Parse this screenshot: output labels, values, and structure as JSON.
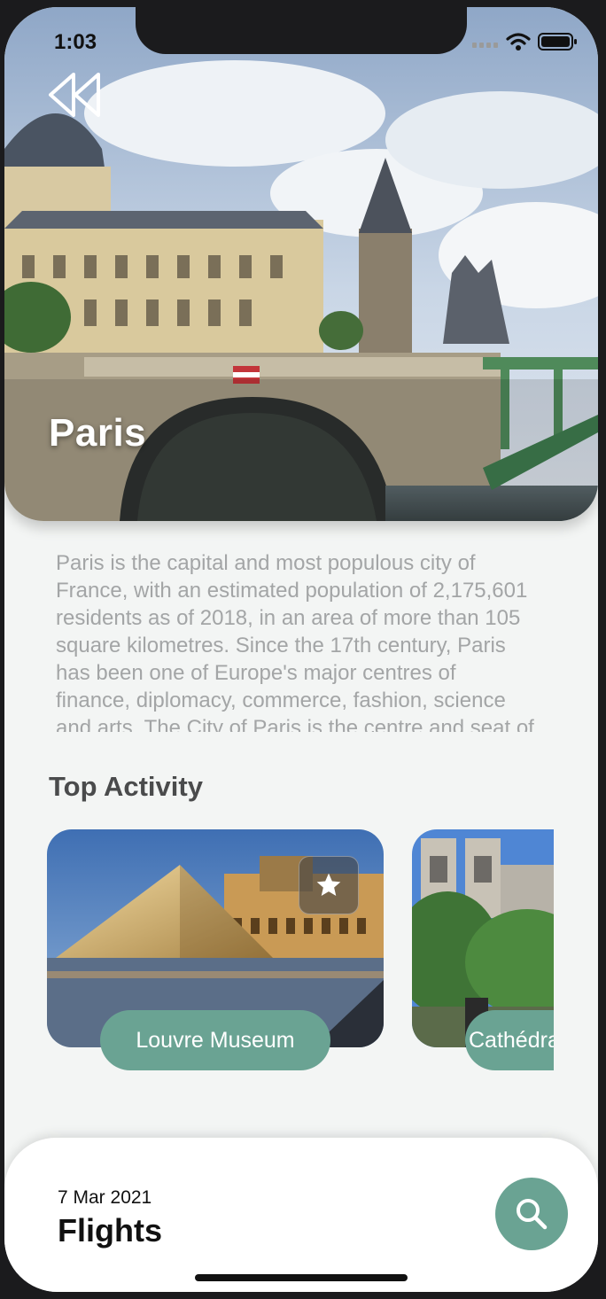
{
  "status_bar": {
    "time": "1:03"
  },
  "destination": {
    "name": "Paris",
    "description": "Paris is the capital and most populous city of France, with an estimated population of 2,175,601 residents as of 2018, in an area of more than 105 square kilometres. Since the 17th century, Paris has been one of Europe's major centres of finance, diplomacy, commerce, fashion, science and arts. The City of Paris is the centre and seat of government of the region and province of Île-de-France."
  },
  "activities": {
    "title": "Top Activity",
    "items": [
      {
        "label": "Louvre Museum"
      },
      {
        "label": "Cathédrale Notre-Dame"
      }
    ]
  },
  "bottom_sheet": {
    "date": "7 Mar 2021",
    "title": "Flights"
  },
  "icons": {
    "back": "rewind-icon",
    "favorite": "star-icon",
    "search": "search-icon",
    "signal": "signal-icon",
    "wifi": "wifi-icon",
    "battery": "battery-icon"
  },
  "colors": {
    "accent": "#6aa393",
    "background": "#f3f5f4",
    "muted_text": "#a3a5a6"
  }
}
